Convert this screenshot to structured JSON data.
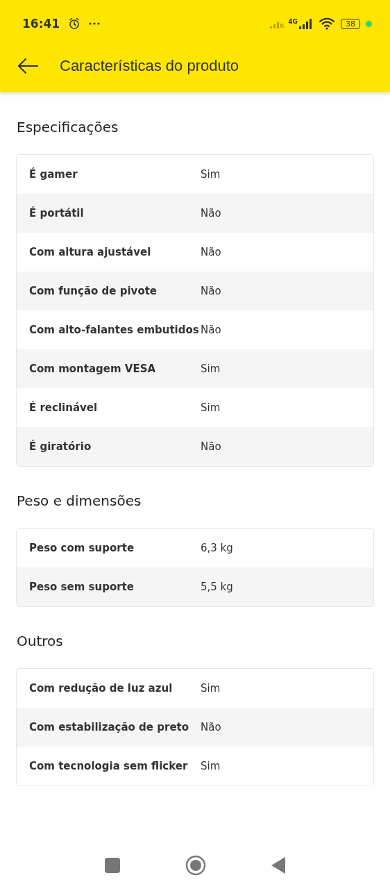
{
  "status_bar": {
    "time": "16:41",
    "network": "4G",
    "battery": "38"
  },
  "app_bar": {
    "title": "Características do produto"
  },
  "sections": [
    {
      "title": "Especificações",
      "rows": [
        {
          "label": "É gamer",
          "value": "Sim"
        },
        {
          "label": "É portátil",
          "value": "Não"
        },
        {
          "label": "Com altura ajustável",
          "value": "Não"
        },
        {
          "label": "Com função de pivote",
          "value": "Não"
        },
        {
          "label": "Com alto-falantes embutidos",
          "value": "Não"
        },
        {
          "label": "Com montagem VESA",
          "value": "Sim"
        },
        {
          "label": "É reclinável",
          "value": "Sim"
        },
        {
          "label": "É giratório",
          "value": "Não"
        }
      ]
    },
    {
      "title": "Peso e dimensões",
      "rows": [
        {
          "label": "Peso com suporte",
          "value": "6,3 kg"
        },
        {
          "label": "Peso sem suporte",
          "value": "5,5 kg"
        }
      ]
    },
    {
      "title": "Outros",
      "rows": [
        {
          "label": "Com redução de luz azul",
          "value": "Sim"
        },
        {
          "label": "Com estabilização de preto",
          "value": "Não"
        },
        {
          "label": "Com tecnologia sem flicker",
          "value": "Sim"
        }
      ]
    }
  ]
}
